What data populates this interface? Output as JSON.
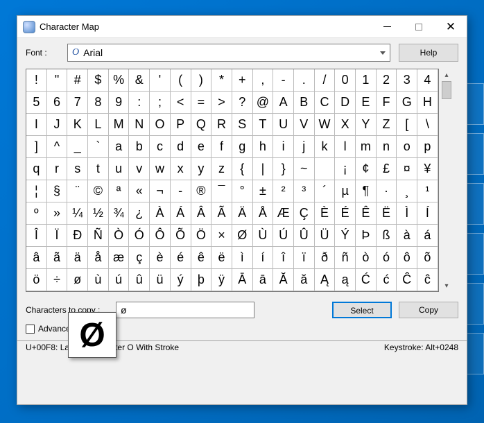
{
  "window": {
    "title": "Character Map",
    "controls": {
      "minimize": "—",
      "maximize": "□",
      "close": "✕"
    }
  },
  "font": {
    "label": "Font :",
    "glyph": "O",
    "selected": "Arial"
  },
  "help_button": "Help",
  "grid_chars": [
    "!",
    "\"",
    "#",
    "$",
    "%",
    "&",
    "'",
    "(",
    ")",
    "*",
    "+",
    ",",
    "-",
    ".",
    "/",
    "0",
    "1",
    "2",
    "3",
    "4",
    "5",
    "6",
    "7",
    "8",
    "9",
    ":",
    ";",
    "<",
    "=",
    ">",
    "?",
    "@",
    "A",
    "B",
    "C",
    "D",
    "E",
    "F",
    "G",
    "H",
    "I",
    "J",
    "K",
    "L",
    "M",
    "N",
    "O",
    "P",
    "Q",
    "R",
    "S",
    "T",
    "U",
    "V",
    "W",
    "X",
    "Y",
    "Z",
    "[",
    "\\",
    "]",
    "^",
    "_",
    "`",
    "a",
    "b",
    "c",
    "d",
    "e",
    "f",
    "g",
    "h",
    "i",
    "j",
    "k",
    "l",
    "m",
    "n",
    "o",
    "p",
    "q",
    "r",
    "s",
    "t",
    "u",
    "v",
    "w",
    "x",
    "y",
    "z",
    "{",
    "|",
    "}",
    "~",
    " ",
    "¡",
    "¢",
    "£",
    "¤",
    "¥",
    "¦",
    "§",
    "¨",
    "©",
    "ª",
    "«",
    "¬",
    "-",
    "®",
    "¯",
    "°",
    "±",
    "²",
    "³",
    "´",
    "µ",
    "¶",
    "·",
    "¸",
    "¹",
    "º",
    "»",
    "¼",
    "½",
    "¾",
    "¿",
    "À",
    "Á",
    "Â",
    "Ã",
    "Ä",
    "Å",
    "Æ",
    "Ç",
    "È",
    "É",
    "Ê",
    "Ë",
    "Ì",
    "Í",
    "Î",
    "Ï",
    "Ð",
    "Ñ",
    "Ò",
    "Ó",
    "Ô",
    "Õ",
    "Ö",
    "×",
    "Ø",
    "Ù",
    "Ú",
    "Û",
    "Ü",
    "Ý",
    "Þ",
    "ß",
    "à",
    "á",
    "â",
    "ã",
    "ä",
    "å",
    "æ",
    "ç",
    "è",
    "é",
    "ê",
    "ë",
    "ì",
    "í",
    "î",
    "ï",
    "ð",
    "ñ",
    "ò",
    "ó",
    "ô",
    "õ",
    "ö",
    "÷",
    "ø",
    "ù",
    "ú",
    "û",
    "ü",
    "ý",
    "þ",
    "ÿ",
    "Ā",
    "ā",
    "Ă",
    "ă",
    "Ą",
    "ą",
    "Ć",
    "ć",
    "Ĉ",
    "ĉ"
  ],
  "magnifier": "Ø",
  "copy": {
    "label": "Characters to copy :",
    "value": "ø",
    "select_button": "Select",
    "copy_button": "Copy"
  },
  "advanced_view_label": "Advanced view",
  "advanced_view_checked": false,
  "status": {
    "left": "U+00F8: Latin Small Letter O With Stroke",
    "right": "Keystroke: Alt+0248"
  }
}
